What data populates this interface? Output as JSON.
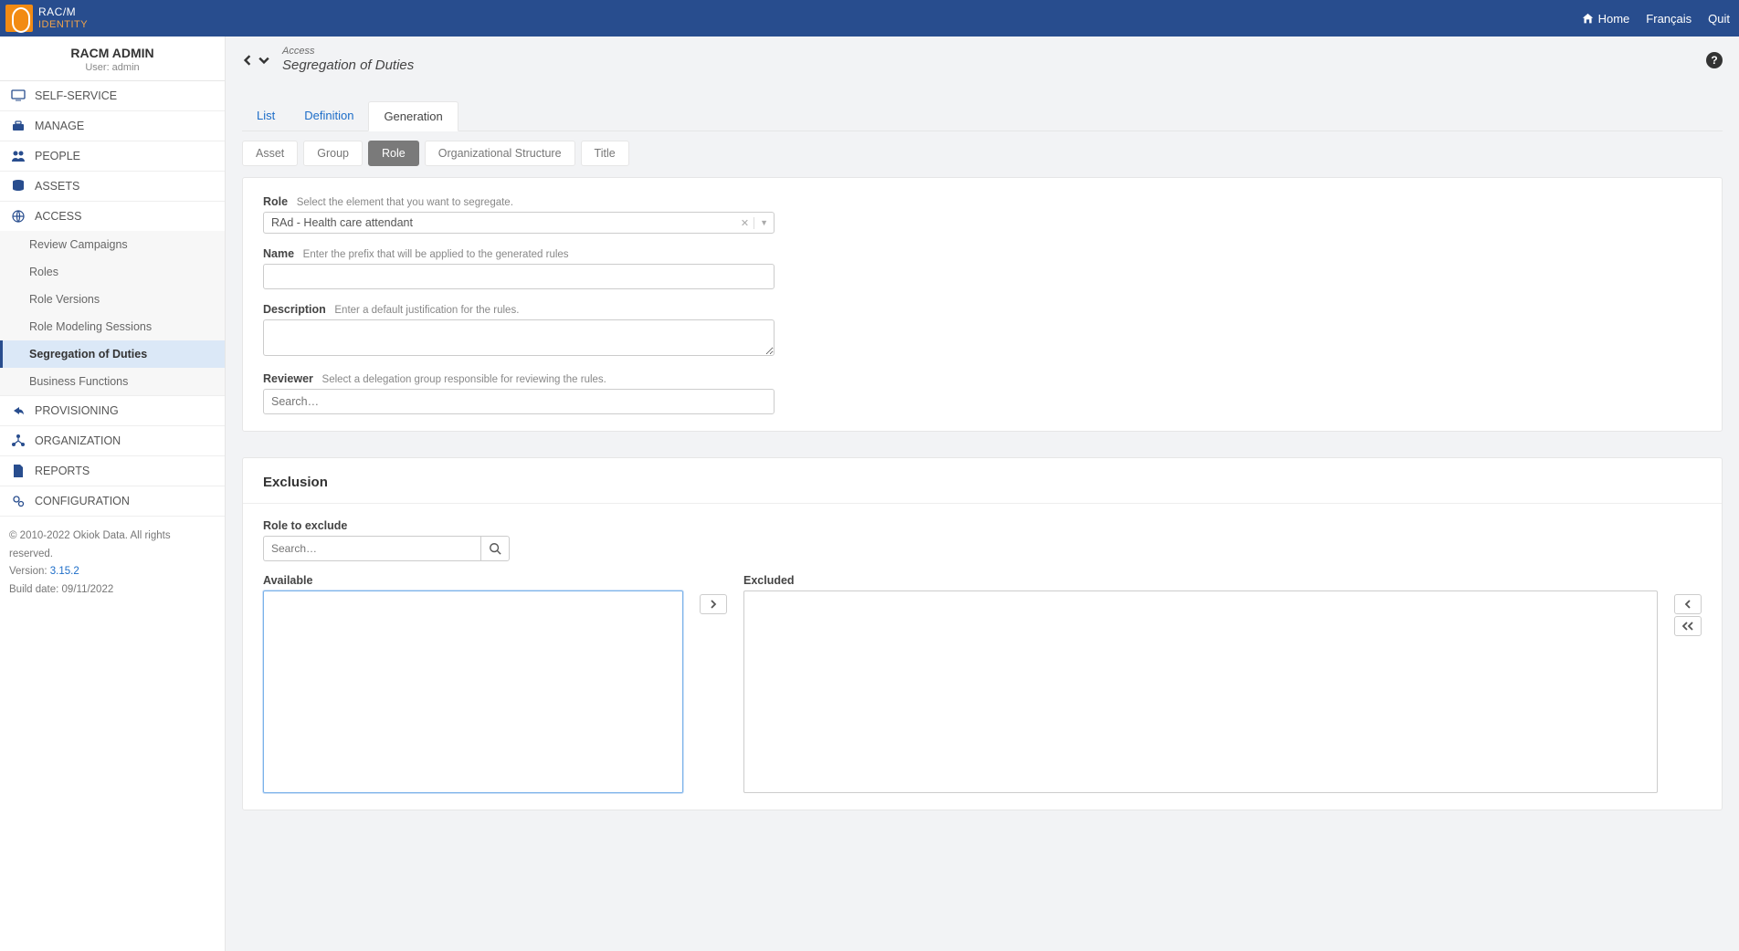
{
  "brand": {
    "line1": "RAC/M",
    "line2": "IDENTITY"
  },
  "topnav": {
    "home": "Home",
    "lang": "Français",
    "quit": "Quit"
  },
  "sidebar": {
    "admin_title": "RACM ADMIN",
    "user_label": "User: admin",
    "items": [
      {
        "label": "SELF-SERVICE"
      },
      {
        "label": "MANAGE"
      },
      {
        "label": "PEOPLE"
      },
      {
        "label": "ASSETS"
      },
      {
        "label": "ACCESS",
        "children": [
          {
            "label": "Review Campaigns"
          },
          {
            "label": "Roles"
          },
          {
            "label": "Role Versions"
          },
          {
            "label": "Role Modeling Sessions"
          },
          {
            "label": "Segregation of Duties",
            "active": true
          },
          {
            "label": "Business Functions"
          }
        ]
      },
      {
        "label": "PROVISIONING"
      },
      {
        "label": "ORGANIZATION"
      },
      {
        "label": "REPORTS"
      },
      {
        "label": "CONFIGURATION"
      }
    ],
    "footer": {
      "copyright": "© 2010-2022 Okiok Data. All rights reserved.",
      "version_label": "Version: ",
      "version": "3.15.2",
      "build": "Build date: 09/11/2022"
    }
  },
  "breadcrumb": {
    "parent": "Access",
    "current": "Segregation of Duties"
  },
  "tabs": [
    "List",
    "Definition",
    "Generation"
  ],
  "active_tab": "Generation",
  "subtabs": [
    "Asset",
    "Group",
    "Role",
    "Organizational Structure",
    "Title"
  ],
  "active_subtab": "Role",
  "form": {
    "role": {
      "label": "Role",
      "hint": "Select the element that you want to segregate.",
      "value": "RAd - Health care attendant"
    },
    "name": {
      "label": "Name",
      "hint": "Enter the prefix that will be applied to the generated rules",
      "value": ""
    },
    "description": {
      "label": "Description",
      "hint": "Enter a default justification for the rules.",
      "value": ""
    },
    "reviewer": {
      "label": "Reviewer",
      "hint": "Select a delegation group responsible for reviewing the rules.",
      "placeholder": "Search…"
    }
  },
  "exclusion": {
    "title": "Exclusion",
    "role_to_exclude": "Role to exclude",
    "search_placeholder": "Search…",
    "available": "Available",
    "excluded": "Excluded"
  }
}
